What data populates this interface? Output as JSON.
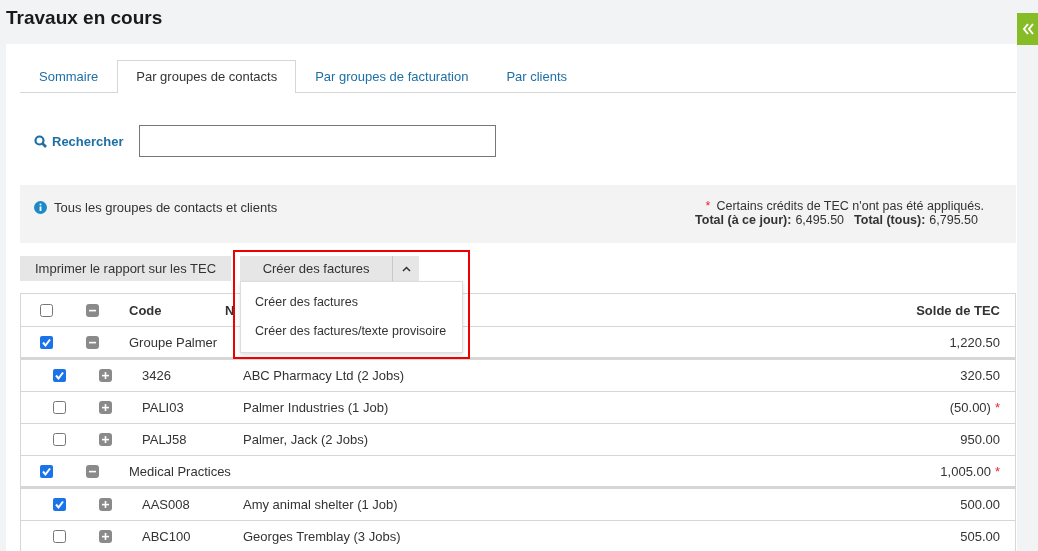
{
  "page_title": "Travaux en cours",
  "tabs": [
    {
      "label": "Sommaire",
      "selected": false
    },
    {
      "label": "Par groupes de contacts",
      "selected": true
    },
    {
      "label": "Par groupes de facturation",
      "selected": false
    },
    {
      "label": "Par clients",
      "selected": false
    }
  ],
  "search": {
    "label": "Rechercher"
  },
  "info": {
    "text": "Tous les groupes de contacts et clients",
    "note_mark": "*",
    "note": "Certains crédits de TEC n'ont pas été appliqués.",
    "totals": [
      {
        "label": "Total (à ce jour):",
        "value": "6,495.50"
      },
      {
        "label": "Total (tous):",
        "value": "6,795.50"
      }
    ]
  },
  "actions": {
    "print_button": "Imprimer le rapport sur les TEC",
    "split_button": {
      "label": "Créer des factures",
      "expanded": true,
      "menu": [
        "Créer des factures",
        "Créer des factures/texte provisoire"
      ]
    }
  },
  "table": {
    "header": {
      "checked": false,
      "expanded": true,
      "columns": [
        "Code",
        "N",
        "Solde de TEC"
      ]
    },
    "rows": [
      {
        "kind": "group",
        "checked": true,
        "expanded": true,
        "code": "Groupe Palmer",
        "balance": "1,220.50"
      },
      {
        "kind": "client",
        "checked": true,
        "expanded": false,
        "code": "3426",
        "name": "ABC Pharmacy Ltd (2 Jobs)",
        "balance": "320.50"
      },
      {
        "kind": "client",
        "checked": false,
        "expanded": false,
        "code": "PALI03",
        "name": "Palmer Industries (1 Job)",
        "balance": "(50.00)",
        "flag": "*"
      },
      {
        "kind": "client",
        "checked": false,
        "expanded": false,
        "code": "PALJ58",
        "name": "Palmer, Jack (2 Jobs)",
        "balance": "950.00"
      },
      {
        "kind": "group",
        "checked": true,
        "expanded": true,
        "code": "Medical Practices",
        "balance": "1,005.00",
        "flag": "*"
      },
      {
        "kind": "client",
        "checked": true,
        "expanded": false,
        "code": "AAS008",
        "name": "Amy animal shelter (1 Job)",
        "balance": "500.00"
      },
      {
        "kind": "client",
        "checked": false,
        "expanded": false,
        "code": "ABC100",
        "name": "Georges Tremblay (3 Jobs)",
        "balance": "505.00"
      }
    ]
  }
}
